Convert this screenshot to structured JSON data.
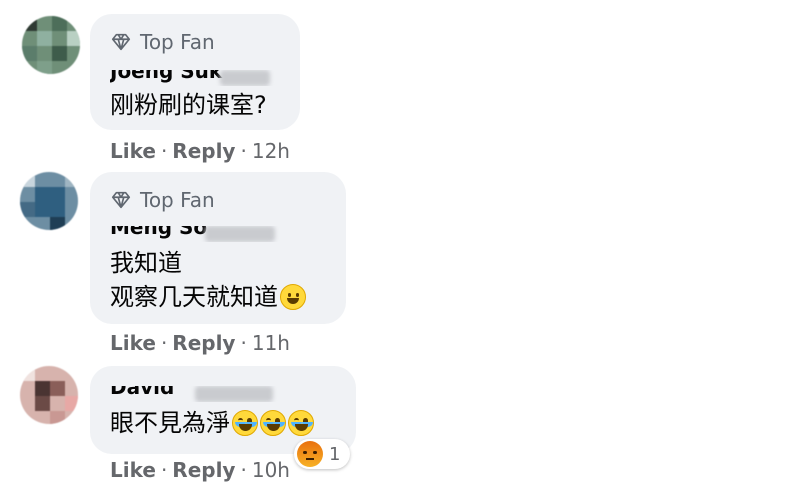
{
  "comments": [
    {
      "badge": "Top Fan",
      "author": "Joeng Suk",
      "lines": [
        "刚粉刷的课室?"
      ],
      "actions": {
        "like": "Like",
        "reply": "Reply",
        "time": "12h"
      }
    },
    {
      "badge": "Top Fan",
      "author": "Meng So",
      "lines": [
        "我知道",
        "观察几天就知道"
      ],
      "actions": {
        "like": "Like",
        "reply": "Reply",
        "time": "11h"
      }
    },
    {
      "author": "David",
      "lines": [
        "眼不見為淨"
      ],
      "actions": {
        "like": "Like",
        "reply": "Reply",
        "time": "10h"
      },
      "reaction": {
        "icon": "angry-reaction-icon",
        "count": "1"
      }
    }
  ],
  "separator": "·",
  "colors": {
    "bubble": "#f0f2f5",
    "meta": "#65676b",
    "text": "#050505"
  }
}
